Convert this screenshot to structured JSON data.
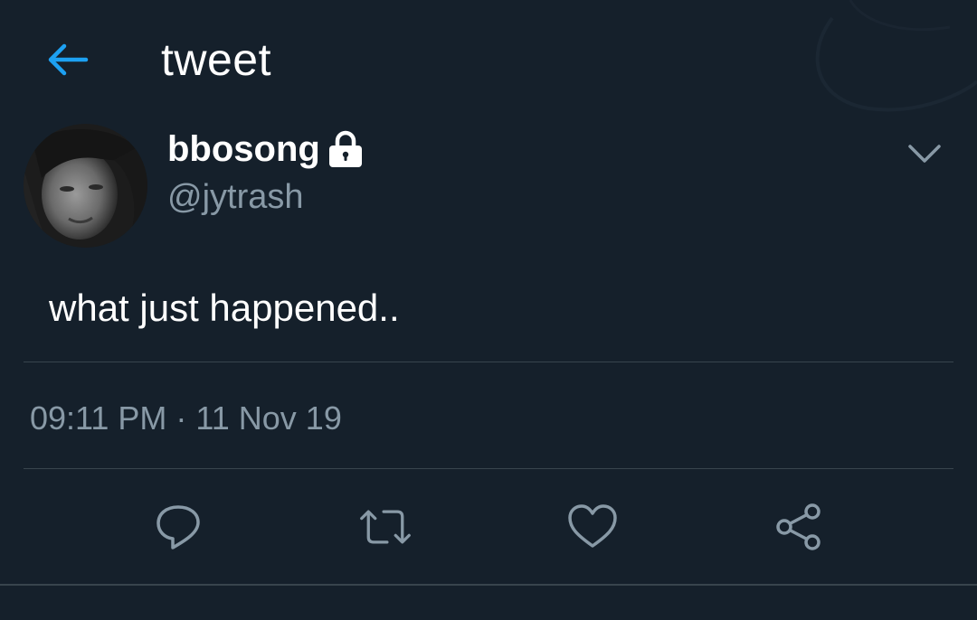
{
  "header": {
    "title": "tweet",
    "back_icon": "arrow-left-icon",
    "accent_color": "#1da1f2"
  },
  "tweet": {
    "author": {
      "display_name": "bbosong",
      "handle": "@jytrash",
      "protected_icon": "lock-icon"
    },
    "text": "what just happened..",
    "timestamp": "09:11 PM · 11 Nov 19",
    "menu_icon": "chevron-down-icon"
  },
  "actions": [
    {
      "name": "reply",
      "icon": "reply-icon"
    },
    {
      "name": "retweet",
      "icon": "retweet-icon"
    },
    {
      "name": "like",
      "icon": "heart-icon"
    },
    {
      "name": "share",
      "icon": "share-icon"
    }
  ],
  "colors": {
    "background": "#15202b",
    "secondary_text": "#8899a6",
    "divider": "#38444d"
  }
}
